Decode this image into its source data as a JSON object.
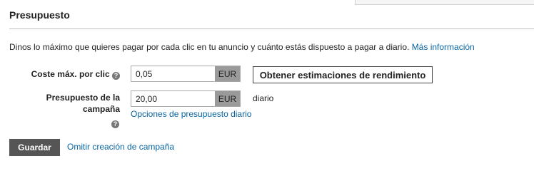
{
  "section": {
    "title": "Presupuesto",
    "description": "Dinos lo máximo que quieres pagar por cada clic en tu anuncio y cuánto estás dispuesto a pagar a diario.",
    "more_info_link": "Más información"
  },
  "max_cpc": {
    "label": "Coste máx. por clic",
    "value": "0,05",
    "currency": "EUR",
    "help_icon": "question-circle-icon"
  },
  "estimate_button": "Obtener estimaciones de rendimiento",
  "budget": {
    "label_line1": "Presupuesto de la",
    "label_line2": "campaña",
    "value": "20,00",
    "currency": "EUR",
    "period": "diario",
    "options_link": "Opciones de presupuesto diario",
    "help_icon": "question-circle-icon"
  },
  "actions": {
    "save": "Guardar",
    "skip": "Omitir creación de campaña"
  },
  "colors": {
    "link": "#0a64a0",
    "save_button_bg": "#555555",
    "currency_bg": "#9a9a9a"
  }
}
